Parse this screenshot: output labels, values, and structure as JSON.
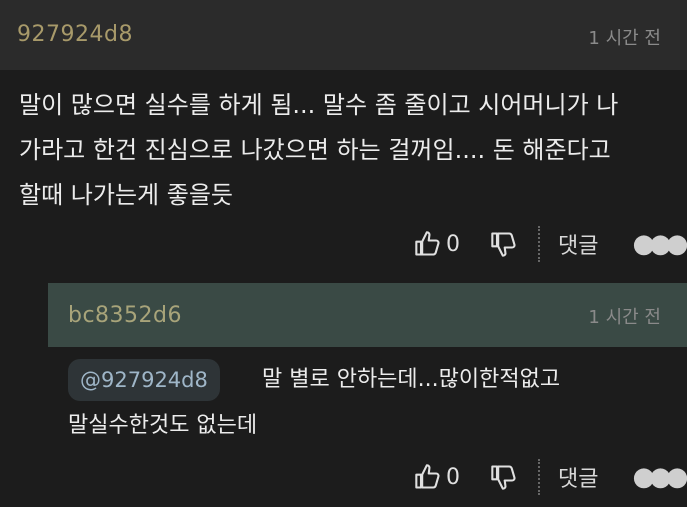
{
  "comment": {
    "author": "927924d8",
    "time": "1 시간 전",
    "body": "말이 많으면 실수를 하게 됨... 말수 좀 줄이고 시어머니가 나\n가라고 한건 진심으로 나갔으면 하는 걸꺼임.... 돈 해준다고\n할때 나가는게 좋을듯",
    "likes": "0",
    "reply_label": "댓글"
  },
  "reply": {
    "author": "bc8352d6",
    "time": "1 시간 전",
    "mention": "@927924d8",
    "line1": "말 별로 안하는데...많이한적없고",
    "line2": "말실수한것도 없는데",
    "likes": "0",
    "reply_label": "댓글"
  },
  "colors": {
    "background": "#1c1c1c",
    "comment_header": "#2b2b2b",
    "reply_header": "#3a4a45",
    "author_text": "#a89a6a",
    "mention_text": "#9fb6c8"
  },
  "icons": [
    "thumbs-up-icon",
    "thumbs-down-icon",
    "more-dots-icon"
  ]
}
